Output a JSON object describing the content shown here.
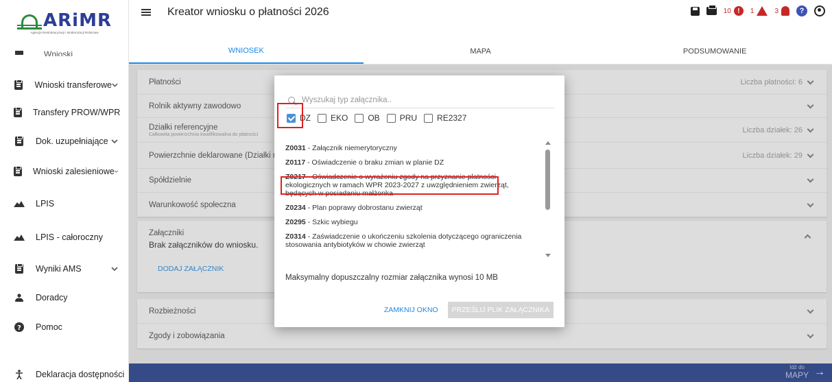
{
  "logo": {
    "text": "ARiMR",
    "subtitle": "Agencja Restrukturyzacji i Modernizacji Rolnictwa"
  },
  "sidebar": {
    "clipped_label": "Wnioski",
    "items": [
      {
        "label": "Wnioski transferowe",
        "icon": "clipboard-icon",
        "expandable": true
      },
      {
        "label": "Transfery PROW/WPR",
        "icon": "clipboard-icon",
        "expandable": true
      },
      {
        "label": "Dok. uzupełniające",
        "icon": "clipboard-icon",
        "expandable": true
      },
      {
        "label": "Wnioski zalesieniowe",
        "icon": "clipboard-icon",
        "expandable": true
      },
      {
        "label": "LPIS",
        "icon": "mountain-icon",
        "expandable": false
      },
      {
        "label": "LPIS - całoroczny",
        "icon": "mountain-icon",
        "expandable": false
      },
      {
        "label": "Wyniki AMS",
        "icon": "clipboard-icon",
        "expandable": true
      },
      {
        "label": "Doradcy",
        "icon": "person-icon",
        "expandable": false
      },
      {
        "label": "Pomoc",
        "icon": "help-icon",
        "expandable": false
      },
      {
        "label": "Deklaracja dostępności",
        "icon": "accessibility-icon",
        "expandable": false
      }
    ]
  },
  "topbar": {
    "title": "Kreator wniosku o płatności 2026",
    "errors_count": "10",
    "warnings_count": "1",
    "notifications_count": "3",
    "help_glyph": "?",
    "error_glyph": "!"
  },
  "tabs": [
    {
      "label": "WNIOSEK",
      "active": true
    },
    {
      "label": "MAPA",
      "active": false
    },
    {
      "label": "PODSUMOWANIE",
      "active": false
    }
  ],
  "sections": {
    "platnosci": {
      "label": "Płatności",
      "right": "Liczba płatności: 6"
    },
    "rolnik": {
      "label": "Rolnik aktywny zawodowo"
    },
    "dzialki": {
      "label": "Działki referencyjne",
      "sub": "Całkowita powierzchnia kwalifikowalna do płatności",
      "right": "Liczba działek: 26"
    },
    "powierzchnie": {
      "label": "Powierzchnie deklarowane (Działki rolne)",
      "right": "Liczba działek: 29"
    },
    "spoldzielnie": {
      "label": "Spółdzielnie"
    },
    "warunkowosc": {
      "label": "Warunkowość społeczna"
    },
    "zalaczniki": {
      "label": "Załączniki",
      "empty": "Brak załączników do wniosku.",
      "add_button": "DODAJ ZAŁĄCZNIK"
    },
    "rozbieznosci": {
      "label": "Rozbieżności"
    },
    "zgody": {
      "label": "Zgody i zobowiązania"
    }
  },
  "bottom": {
    "go_label": "Idź do",
    "go_target": "MAPY",
    "arrow": "→"
  },
  "modal": {
    "search_placeholder": "Wyszukaj typ załącznika..",
    "filters": [
      {
        "label": "DZ",
        "checked": true
      },
      {
        "label": "EKO",
        "checked": false
      },
      {
        "label": "OB",
        "checked": false
      },
      {
        "label": "PRU",
        "checked": false
      },
      {
        "label": "RE2327",
        "checked": false
      }
    ],
    "items": [
      {
        "code": "Z0031",
        "text": " - Załącznik niemerytoryczny"
      },
      {
        "code": "Z0117",
        "text": " - Oświadczenie o braku zmian w planie DZ"
      },
      {
        "code": "Z0217",
        "text": " - Oświadczenie o wyrażeniu zgody na przyznanie płatności ekologicznych w ramach WPR 2023-2027 z uwzględnieniem zwierząt, będących w posiadaniu małżonka"
      },
      {
        "code": "Z0234",
        "text": " - Plan poprawy dobrostanu zwierząt"
      },
      {
        "code": "Z0295",
        "text": " - Szkic wybiegu"
      },
      {
        "code": "Z0314",
        "text": " - Zaświadczenie o ukończeniu szkolenia dotyczącego ograniczenia stosowania antybiotyków w chowie zwierząt"
      }
    ],
    "max_size": "Maksymalny dopuszczalny rozmiar załącznika wynosi 10 MB",
    "close_button": "ZAMKNIJ OKNO",
    "send_button": "PRZEŚLIJ PLIK ZAŁĄCZNIKA"
  }
}
